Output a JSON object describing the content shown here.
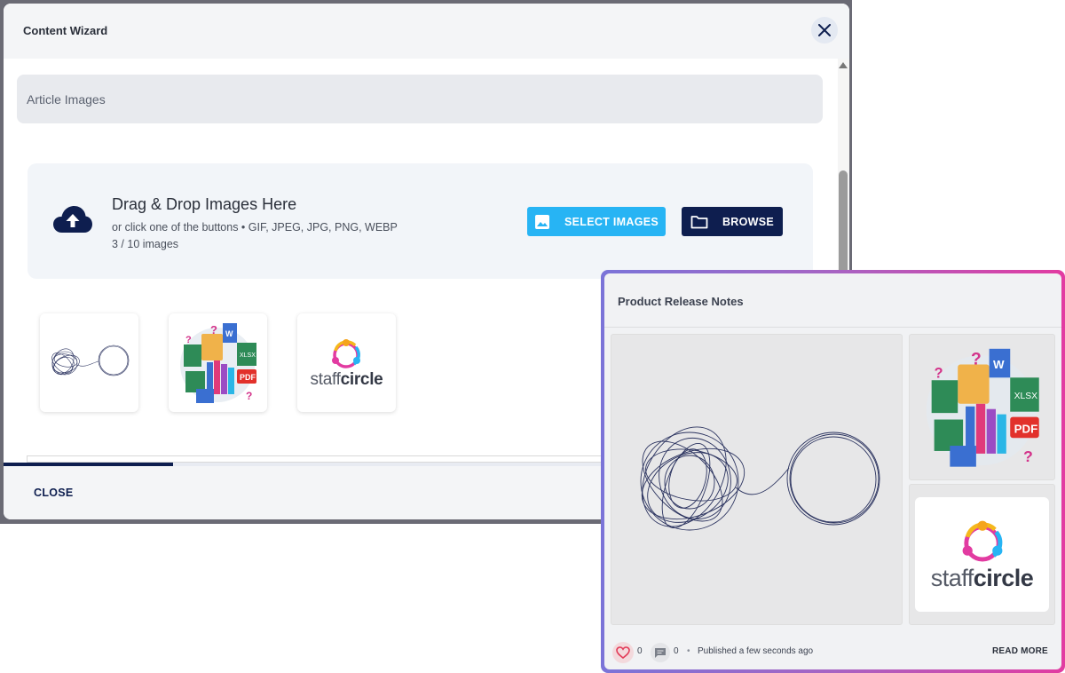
{
  "wizard": {
    "title": "Content Wizard",
    "section_title": "Article Images",
    "dropzone": {
      "title": "Drag & Drop Images Here",
      "subtitle": "or click one of the buttons • GIF, JPEG, JPG, PNG, WEBP",
      "count": "3 / 10 images",
      "select_label": "SELECT IMAGES",
      "browse_label": "BROWSE"
    },
    "thumbnails": [
      {
        "name": "scribble-circle-image"
      },
      {
        "name": "documents-collage-image"
      },
      {
        "name": "staffcircle-logo-image",
        "brand_light": "staff",
        "brand_bold": "circle"
      }
    ],
    "progress": 0.2,
    "close_label": "CLOSE"
  },
  "card": {
    "title": "Product Release Notes",
    "logo_light": "staff",
    "logo_bold": "circle",
    "likes": "0",
    "comments": "0",
    "separator": "•",
    "published": "Published a few seconds ago",
    "read_more": "READ MORE"
  },
  "colors": {
    "primary_navy": "#0e1e4f",
    "select_blue": "#27b4f4",
    "heart_red": "#e23b58",
    "gradient_start": "#7b74d8",
    "gradient_end": "#e23ba1"
  },
  "icons": [
    "close-icon",
    "cloud-upload-icon",
    "image-icon",
    "folder-icon",
    "heart-icon",
    "comment-icon"
  ]
}
